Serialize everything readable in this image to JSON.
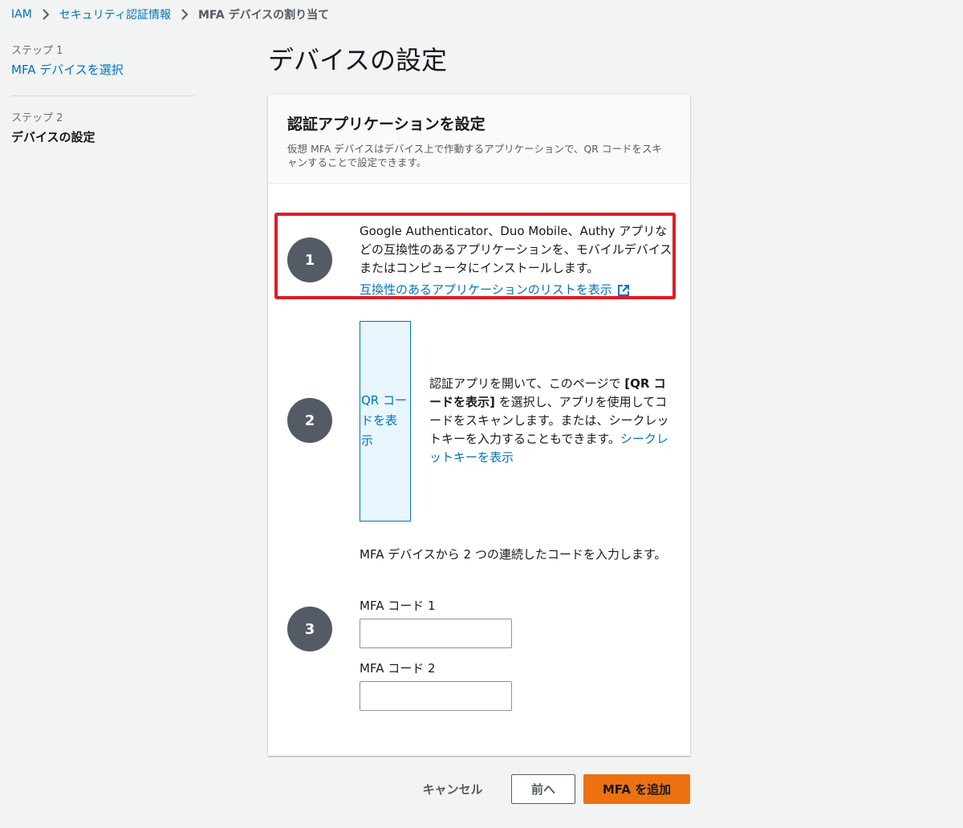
{
  "breadcrumb": {
    "items": [
      "IAM",
      "セキュリティ認証情報"
    ],
    "current": "MFA デバイスの割り当て"
  },
  "steps": [
    {
      "label": "ステップ 1",
      "title": "MFA デバイスを選択"
    },
    {
      "label": "ステップ 2",
      "title": "デバイスの設定"
    }
  ],
  "page_title": "デバイスの設定",
  "panel": {
    "title": "認証アプリケーションを設定",
    "description": "仮想 MFA デバイスはデバイス上で作動するアプリケーションで、QR コードをスキャンすることで設定できます。",
    "step1": {
      "number": "1",
      "text": "Google Authenticator、Duo Mobile、Authy アプリなどの互換性のあるアプリケーションを、モバイルデバイスまたはコンピュータにインストールします。",
      "link": "互換性のあるアプリケーションのリストを表示"
    },
    "step2": {
      "number": "2",
      "qr_button": "QR コードを表示",
      "text_before": "認証アプリを開いて、このページで ",
      "text_bold": "[QR コードを表示]",
      "text_after": " を選択し、アプリを使用してコードをスキャンします。または、シークレットキーを入力することもできます。",
      "secret_link": "シークレットキーを表示"
    },
    "step3": {
      "number": "3",
      "intro": "MFA デバイスから 2 つの連続したコードを入力します。",
      "code1_label": "MFA コード 1",
      "code1_value": "",
      "code2_label": "MFA コード 2",
      "code2_value": ""
    }
  },
  "footer": {
    "cancel": "キャンセル",
    "back": "前へ",
    "add": "MFA を追加"
  },
  "colors": {
    "link": "#0073bb",
    "primary_button": "#ec7211",
    "highlight_border": "#e01b24",
    "step_circle": "#545b64"
  }
}
